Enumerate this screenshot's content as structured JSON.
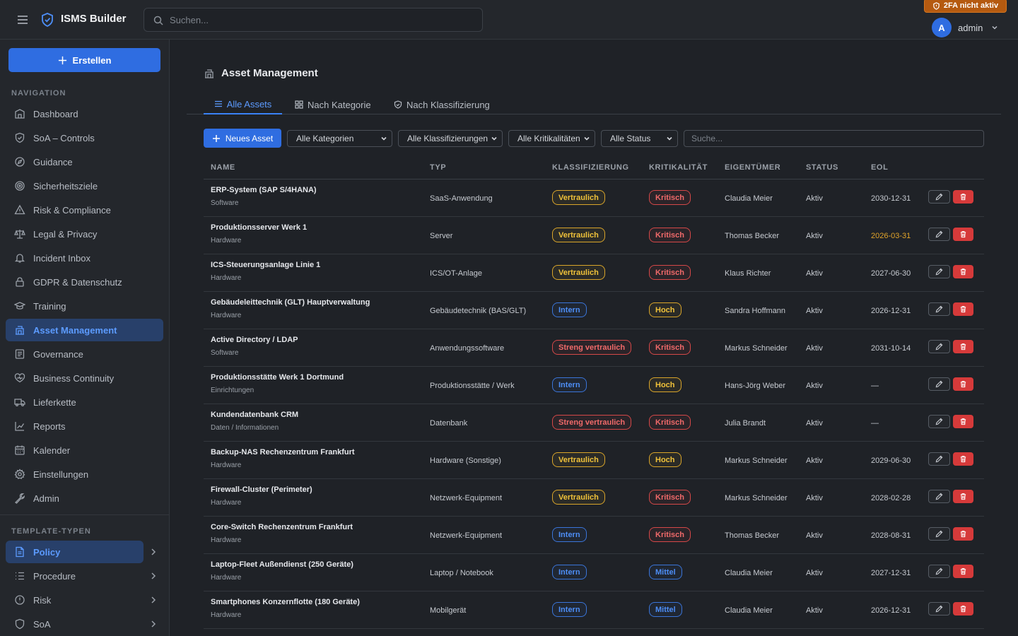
{
  "header": {
    "brand": "ISMS Builder",
    "search_placeholder": "Suchen...",
    "twofa_badge": "2FA nicht aktiv",
    "user": {
      "initial": "A",
      "name": "admin"
    },
    "icons": [
      "menu-icon",
      "shield-logo-icon",
      "search-icon",
      "shield-warning-icon",
      "chevron-down-icon"
    ]
  },
  "sidebar": {
    "create_label": "Erstellen",
    "section_navigation": "NAVIGATION",
    "nav": [
      {
        "label": "Dashboard",
        "icon": "dashboard-icon"
      },
      {
        "label": "SoA – Controls",
        "icon": "shield-check-icon"
      },
      {
        "label": "Guidance",
        "icon": "compass-icon"
      },
      {
        "label": "Sicherheitsziele",
        "icon": "target-icon"
      },
      {
        "label": "Risk & Compliance",
        "icon": "warning-triangle-icon"
      },
      {
        "label": "Legal & Privacy",
        "icon": "scale-icon"
      },
      {
        "label": "Incident Inbox",
        "icon": "bell-icon"
      },
      {
        "label": "GDPR & Datenschutz",
        "icon": "lock-icon"
      },
      {
        "label": "Training",
        "icon": "graduation-cap-icon"
      },
      {
        "label": "Asset Management",
        "icon": "building-icon",
        "active": true
      },
      {
        "label": "Governance",
        "icon": "document-icon"
      },
      {
        "label": "Business Continuity",
        "icon": "heart-shield-icon"
      },
      {
        "label": "Lieferkette",
        "icon": "truck-icon"
      },
      {
        "label": "Reports",
        "icon": "chart-icon"
      },
      {
        "label": "Kalender",
        "icon": "calendar-icon"
      },
      {
        "label": "Einstellungen",
        "icon": "gear-icon"
      },
      {
        "label": "Admin",
        "icon": "wrench-icon"
      }
    ],
    "section_templates": "TEMPLATE-TYPEN",
    "templates": [
      {
        "label": "Policy",
        "icon": "policy-icon",
        "active": true
      },
      {
        "label": "Procedure",
        "icon": "list-icon"
      },
      {
        "label": "Risk",
        "icon": "info-circle-icon"
      },
      {
        "label": "SoA",
        "icon": "shield-icon"
      }
    ]
  },
  "page": {
    "title": "Asset Management",
    "tabs": [
      {
        "label": "Alle Assets",
        "icon": "list-icon",
        "active": true
      },
      {
        "label": "Nach Kategorie",
        "icon": "grid-icon"
      },
      {
        "label": "Nach Klassifizierung",
        "icon": "shield-icon"
      }
    ],
    "new_asset": "Neues Asset",
    "filters": {
      "kategorie": "Alle Kategorien",
      "klassifizierung": "Alle Klassifizierungen",
      "kritikalitaet": "Alle Kritikalitäten",
      "status": "Alle Status",
      "search_placeholder": "Suche..."
    }
  },
  "table": {
    "headers": {
      "name": "NAME",
      "typ": "TYP",
      "klass": "KLASSIFIZIERUNG",
      "krit": "KRITIKALITÄT",
      "owner": "EIGENTÜMER",
      "status": "STATUS",
      "eol": "EOL"
    },
    "rows": [
      {
        "name": "ERP-System (SAP S/4HANA)",
        "category": "Software",
        "type": "SaaS-Anwendung",
        "classification": "Vertraulich",
        "criticality": "Kritisch",
        "owner": "Claudia Meier",
        "status": "Aktiv",
        "eol": "2030-12-31"
      },
      {
        "name": "Produktionsserver Werk 1",
        "category": "Hardware",
        "type": "Server",
        "classification": "Vertraulich",
        "criticality": "Kritisch",
        "owner": "Thomas Becker",
        "status": "Aktiv",
        "eol": "2026-03-31",
        "eol_warning": true
      },
      {
        "name": "ICS-Steuerungsanlage Linie 1",
        "category": "Hardware",
        "type": "ICS/OT-Anlage",
        "classification": "Vertraulich",
        "criticality": "Kritisch",
        "owner": "Klaus Richter",
        "status": "Aktiv",
        "eol": "2027-06-30"
      },
      {
        "name": "Gebäudeleittechnik (GLT) Hauptverwaltung",
        "category": "Hardware",
        "type": "Gebäudetechnik (BAS/GLT)",
        "classification": "Intern",
        "criticality": "Hoch",
        "owner": "Sandra Hoffmann",
        "status": "Aktiv",
        "eol": "2026-12-31"
      },
      {
        "name": "Active Directory / LDAP",
        "category": "Software",
        "type": "Anwendungssoftware",
        "classification": "Streng vertraulich",
        "criticality": "Kritisch",
        "owner": "Markus Schneider",
        "status": "Aktiv",
        "eol": "2031-10-14"
      },
      {
        "name": "Produktionsstätte Werk 1 Dortmund",
        "category": "Einrichtungen",
        "type": "Produktionsstätte / Werk",
        "classification": "Intern",
        "criticality": "Hoch",
        "owner": "Hans-Jörg Weber",
        "status": "Aktiv",
        "eol": "—"
      },
      {
        "name": "Kundendatenbank CRM",
        "category": "Daten / Informationen",
        "type": "Datenbank",
        "classification": "Streng vertraulich",
        "criticality": "Kritisch",
        "owner": "Julia Brandt",
        "status": "Aktiv",
        "eol": "—"
      },
      {
        "name": "Backup-NAS Rechenzentrum Frankfurt",
        "category": "Hardware",
        "type": "Hardware (Sonstige)",
        "classification": "Vertraulich",
        "criticality": "Hoch",
        "owner": "Markus Schneider",
        "status": "Aktiv",
        "eol": "2029-06-30"
      },
      {
        "name": "Firewall-Cluster (Perimeter)",
        "category": "Hardware",
        "type": "Netzwerk-Equipment",
        "classification": "Vertraulich",
        "criticality": "Kritisch",
        "owner": "Markus Schneider",
        "status": "Aktiv",
        "eol": "2028-02-28"
      },
      {
        "name": "Core-Switch Rechenzentrum Frankfurt",
        "category": "Hardware",
        "type": "Netzwerk-Equipment",
        "classification": "Intern",
        "criticality": "Kritisch",
        "owner": "Thomas Becker",
        "status": "Aktiv",
        "eol": "2028-08-31"
      },
      {
        "name": "Laptop-Fleet Außendienst (250 Geräte)",
        "category": "Hardware",
        "type": "Laptop / Notebook",
        "classification": "Intern",
        "criticality": "Mittel",
        "owner": "Claudia Meier",
        "status": "Aktiv",
        "eol": "2027-12-31"
      },
      {
        "name": "Smartphones Konzernflotte (180 Geräte)",
        "category": "Hardware",
        "type": "Mobilgerät",
        "classification": "Intern",
        "criticality": "Mittel",
        "owner": "Claudia Meier",
        "status": "Aktiv",
        "eol": "2026-12-31"
      }
    ]
  },
  "colors": {
    "accent": "#2f6de1",
    "active_bg": "#28406a",
    "warning": "#b55a10",
    "yellow": "#f0c23a",
    "red": "#f06a6a",
    "blue": "#4d8ef7"
  }
}
